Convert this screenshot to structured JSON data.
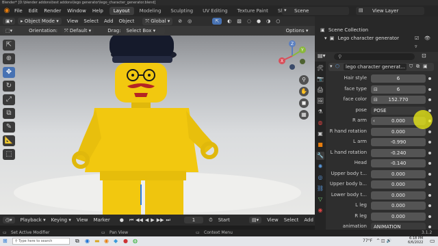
{
  "window": {
    "title": "Blender* [D:\\blender addons\\test addons\\lego generator\\lego_character_generator.blend]"
  },
  "menu": {
    "items": [
      "File",
      "Edit",
      "Render",
      "Window",
      "Help"
    ]
  },
  "workspaces": [
    "Layout",
    "Modeling",
    "Sculpting",
    "UV Editing",
    "Texture Paint",
    "Shading"
  ],
  "scene": {
    "name": "Scene"
  },
  "view_layer": {
    "name": "View Layer"
  },
  "viewport_header": {
    "mode": "Object Mode",
    "menus": [
      "View",
      "Select",
      "Add",
      "Object"
    ],
    "transform": "Global"
  },
  "tool_header": {
    "orientation_label": "Orientation:",
    "orientation_value": "Default",
    "drag_label": "Drag:",
    "drag_value": "Select Box",
    "options_label": "Options"
  },
  "gizmo": {
    "z": "Z",
    "y": "Y",
    "x": "X"
  },
  "timeline": {
    "playback": "Playback",
    "keying": "Keying",
    "view": "View",
    "marker": "Marker",
    "frame": "1",
    "start_label": "Start",
    "view2": "View",
    "select": "Select",
    "add": "Add"
  },
  "outliner": {
    "scene_collection": "Scene Collection",
    "item": "Lego character generator"
  },
  "properties": {
    "panel_title": "lego character generat...",
    "rows": [
      {
        "label": "Hair style",
        "value": "6"
      },
      {
        "label": "face type",
        "value": "6"
      },
      {
        "label": "face color",
        "value": "152.770"
      },
      {
        "label": "pose",
        "value": "POSE"
      },
      {
        "label": "R arm",
        "value": "0.000"
      },
      {
        "label": "R hand rotation",
        "value": "0.000"
      },
      {
        "label": "L arm",
        "value": "-0.990"
      },
      {
        "label": "L hand rotation",
        "value": "-0.240"
      },
      {
        "label": "Head",
        "value": "-0.140"
      },
      {
        "label": "Upper body t...",
        "value": "0.000"
      },
      {
        "label": "Upper body b...",
        "value": "0.000"
      },
      {
        "label": "Lower body t...",
        "value": "0.000"
      },
      {
        "label": "L leg",
        "value": "0.000"
      },
      {
        "label": "R leg",
        "value": "0.000"
      },
      {
        "label": "animation",
        "value": "ANIMATION"
      }
    ]
  },
  "statusbar": {
    "left": "Set Active Modifier",
    "middle": "Pan View",
    "right": "Context Menu",
    "version": "3.1.2"
  },
  "taskbar": {
    "search_placeholder": "Type here to search",
    "weather": "77°F",
    "time": "6:18 PM",
    "date": "6/6/2022"
  },
  "colors": {
    "accent": "#4772b3",
    "lego_yellow": "#f2c80f",
    "blender_orange": "#e87d0d"
  }
}
